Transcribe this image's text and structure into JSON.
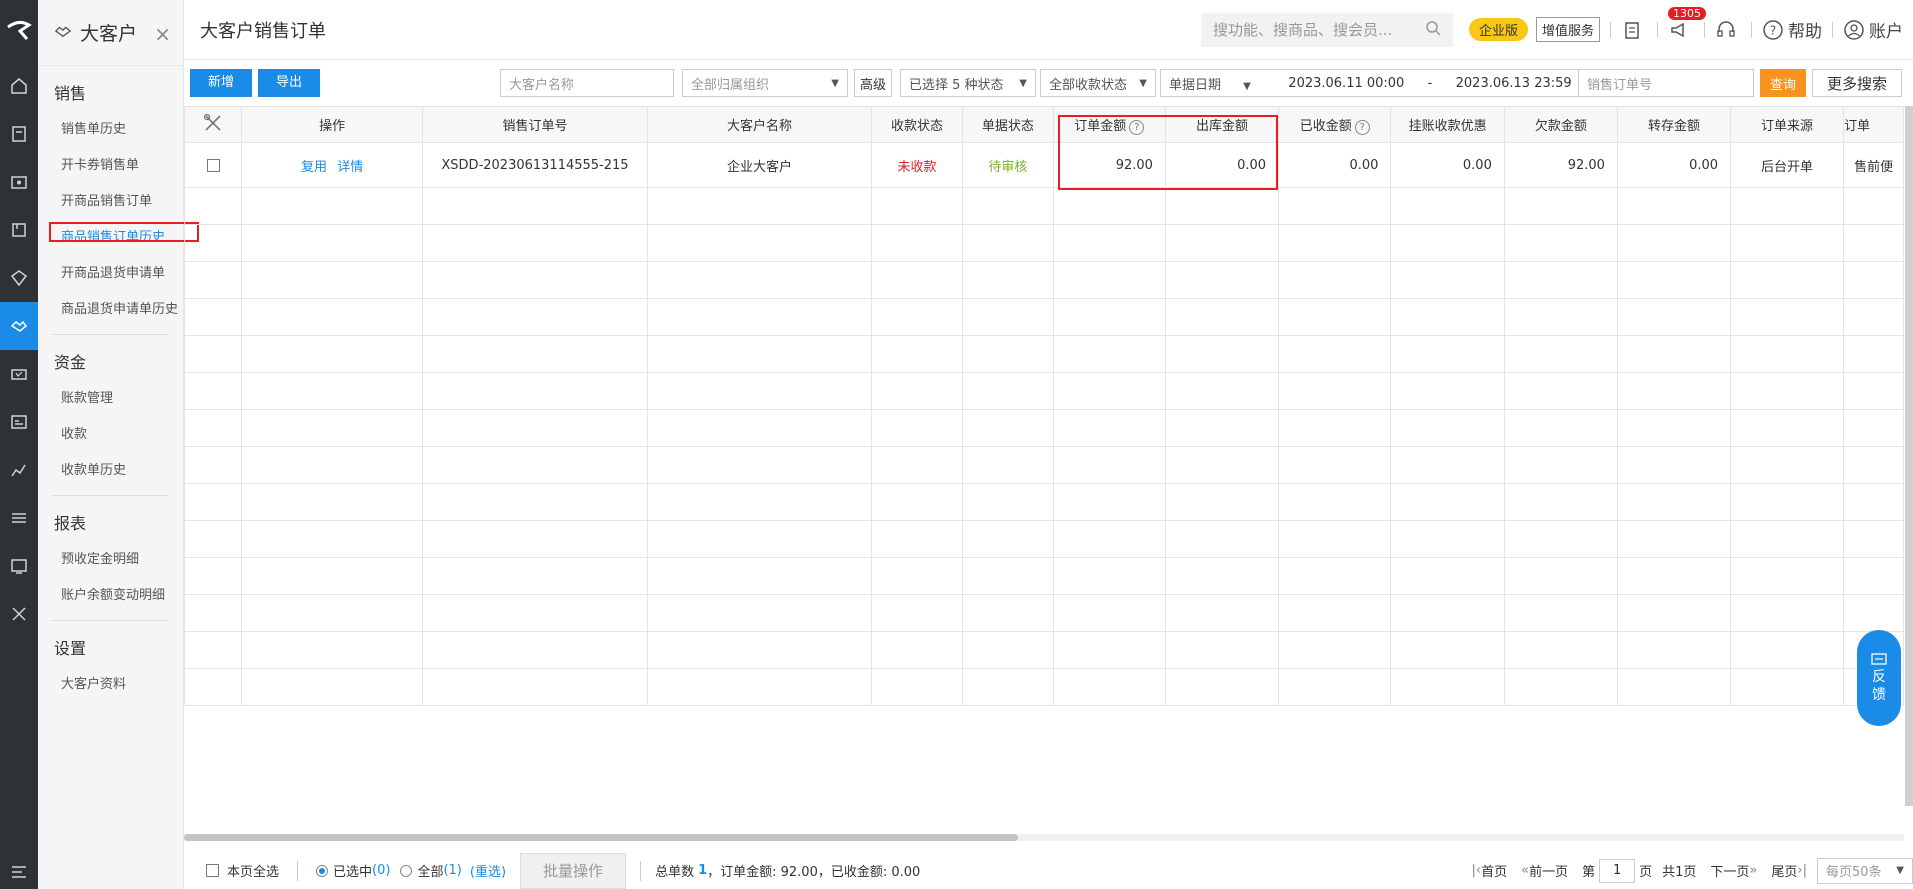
{
  "sidebar": {
    "title": "大客户",
    "sections": [
      {
        "title": "销售",
        "items": [
          "销售单历史",
          "开卡券销售单",
          "开商品销售订单",
          "商品销售订单历史",
          "开商品退货申请单",
          "商品退货申请单历史"
        ]
      },
      {
        "title": "资金",
        "items": [
          "账款管理",
          "收款",
          "收款单历史"
        ]
      },
      {
        "title": "报表",
        "items": [
          "预收定金明细",
          "账户余额变动明细"
        ]
      },
      {
        "title": "设置",
        "items": [
          "大客户资料"
        ]
      }
    ]
  },
  "header": {
    "title": "大客户销售订单",
    "search_placeholder": "搜功能、搜商品、搜会员...",
    "edition_badge": "企业版",
    "value_added": "增值服务",
    "notif_count": "1305",
    "help": "帮助",
    "account": "账户"
  },
  "toolbar": {
    "add": "新增",
    "export": "导出",
    "customer_placeholder": "大客户名称",
    "org": "全部归属组织",
    "advanced": "高级",
    "status_sel": "已选择 5 种状态",
    "pay_status": "全部收款状态",
    "date_type": "单据日期",
    "date_from": "2023.06.11 00:00",
    "date_sep": "-",
    "date_to": "2023.06.13 23:59",
    "order_placeholder": "销售订单号",
    "query": "查询",
    "more": "更多搜索"
  },
  "table": {
    "headers": {
      "op": "操作",
      "order_no": "销售订单号",
      "customer": "大客户名称",
      "pay_status": "收款状态",
      "doc_status": "单据状态",
      "order_amount": "订单金额",
      "out_amount": "出库金额",
      "received": "已收金额",
      "discount": "挂账收款优惠",
      "owed": "欠款金额",
      "transfer": "转存金额",
      "source": "订单来源",
      "trunc": "订单"
    },
    "row": {
      "reuse": "复用",
      "detail": "详情",
      "order_no": "XSDD-20230613114555-215",
      "customer": "企业大客户",
      "pay_status": "未收款",
      "doc_status": "待审核",
      "order_amount": "92.00",
      "out_amount": "0.00",
      "received": "0.00",
      "discount": "0.00",
      "owed": "92.00",
      "transfer": "0.00",
      "source": "后台开单",
      "trunc": "售前便"
    }
  },
  "footer": {
    "select_page": "本页全选",
    "selected": "已选中",
    "selected_count": "(0)",
    "all": "全部",
    "all_count": "(1)",
    "reselect": "(重选)",
    "bulk": "批量操作",
    "summary_prefix": "总单数",
    "summary_count": "1",
    "summary_rest": "，订单金额: 92.00，已收金额: 0.00",
    "first": "首页",
    "prev": "前一页",
    "page_prefix": "第",
    "page": "1",
    "page_suffix": "页",
    "total_pages": "共1页",
    "next": "下一页",
    "last": "尾页",
    "per_page": "每页50条"
  },
  "feedback": {
    "l1": "反",
    "l2": "馈"
  }
}
